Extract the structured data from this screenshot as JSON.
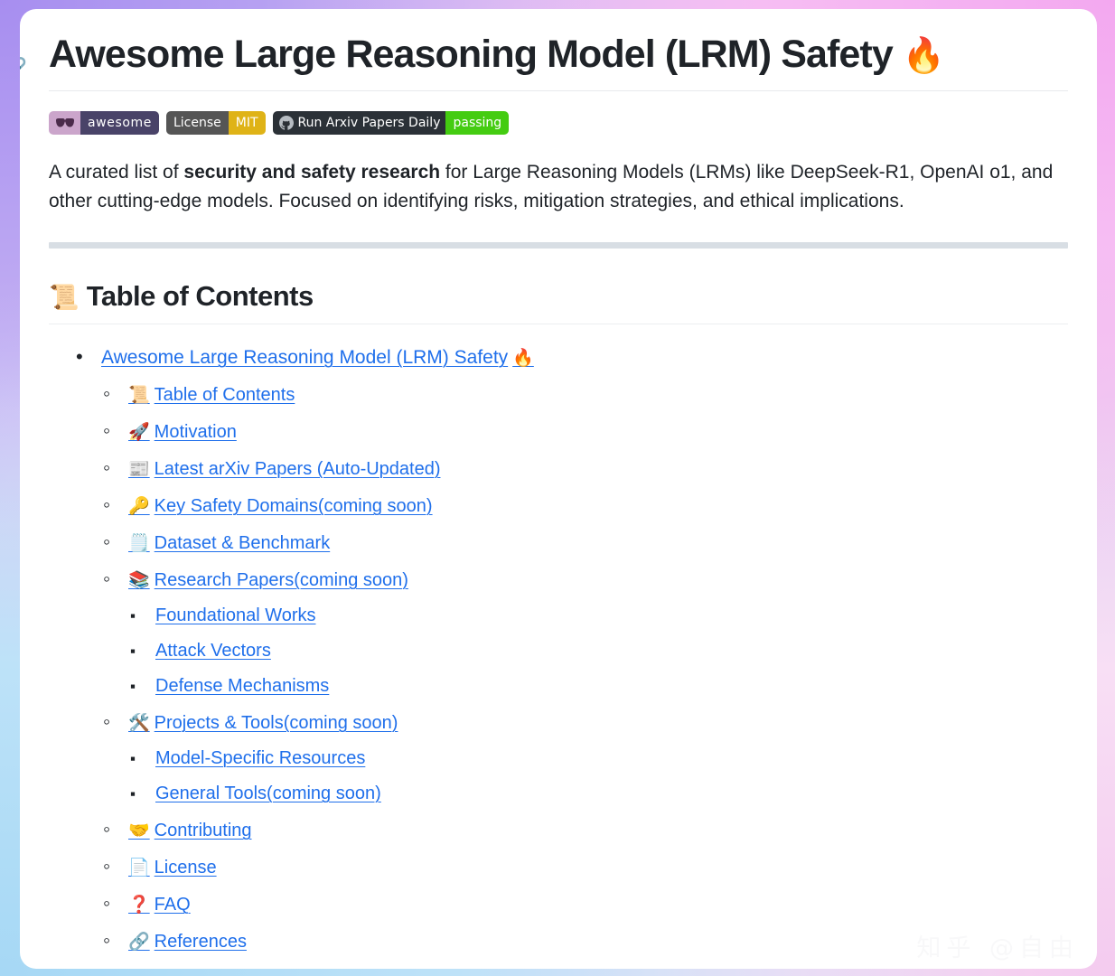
{
  "theme": {
    "card_bg": "#ffffff",
    "link_color": "#1f6feb",
    "text_color": "#1f2328",
    "hr_color": "#d8dee4",
    "bg_purple": "#b49cf0",
    "bg_pink": "#f3a8f0",
    "bg_blue": "#a6d8f5"
  },
  "header": {
    "anchor_icon": "anchor-link-icon",
    "title": "Awesome Large Reasoning Model (LRM) Safety",
    "title_emoji": "🔥"
  },
  "badges": [
    {
      "name": "awesome-badge",
      "icon": "sunglasses-icon",
      "left_label": "",
      "right_label": "awesome",
      "left_color": "#cba5cb",
      "right_color": "#494368"
    },
    {
      "name": "license-badge",
      "icon": "",
      "left_label": "License",
      "right_label": "MIT",
      "left_color": "#555555",
      "right_color": "#dfb317"
    },
    {
      "name": "ci-status-badge",
      "icon": "github-icon",
      "left_label": "Run Arxiv Papers Daily",
      "right_label": "passing",
      "left_color": "#2b3137",
      "right_color": "#44cc11"
    }
  ],
  "intro": {
    "part1": "A curated list of ",
    "bold": "security and safety research",
    "part2": " for Large Reasoning Models (LRMs) like DeepSeek-R1, OpenAI o1, and other cutting-edge models. Focused on identifying risks, mitigation strategies, and ethical implications."
  },
  "toc": {
    "heading_emoji": "📜",
    "heading": "Table of Contents",
    "root": {
      "emoji_trailing": "🔥",
      "label": "Awesome Large Reasoning Model (LRM) Safety"
    },
    "items": [
      {
        "emoji": "📜",
        "label": "Table of Contents",
        "children": []
      },
      {
        "emoji": "🚀",
        "label": "Motivation",
        "children": []
      },
      {
        "emoji": "📰",
        "label": "Latest arXiv Papers (Auto-Updated)",
        "children": []
      },
      {
        "emoji": "🔑",
        "label": "Key Safety Domains(coming soon)",
        "children": []
      },
      {
        "emoji": "🗒️",
        "label": "Dataset & Benchmark",
        "children": []
      },
      {
        "emoji": "📚",
        "label": "Research Papers(coming soon)",
        "children": [
          {
            "label": "Foundational Works"
          },
          {
            "label": "Attack Vectors"
          },
          {
            "label": "Defense Mechanisms"
          }
        ]
      },
      {
        "emoji": "🛠️",
        "label": "Projects & Tools(coming soon)",
        "children": [
          {
            "label": "Model-Specific Resources"
          },
          {
            "label": "General Tools(coming soon)"
          }
        ]
      },
      {
        "emoji": "🤝",
        "label": "Contributing",
        "children": []
      },
      {
        "emoji": "📄",
        "label": "License",
        "children": []
      },
      {
        "emoji": "❓",
        "label": "FAQ",
        "children": []
      },
      {
        "emoji": "🔗",
        "label": "References",
        "children": []
      }
    ]
  },
  "watermark": {
    "text": "知乎 @自由"
  }
}
